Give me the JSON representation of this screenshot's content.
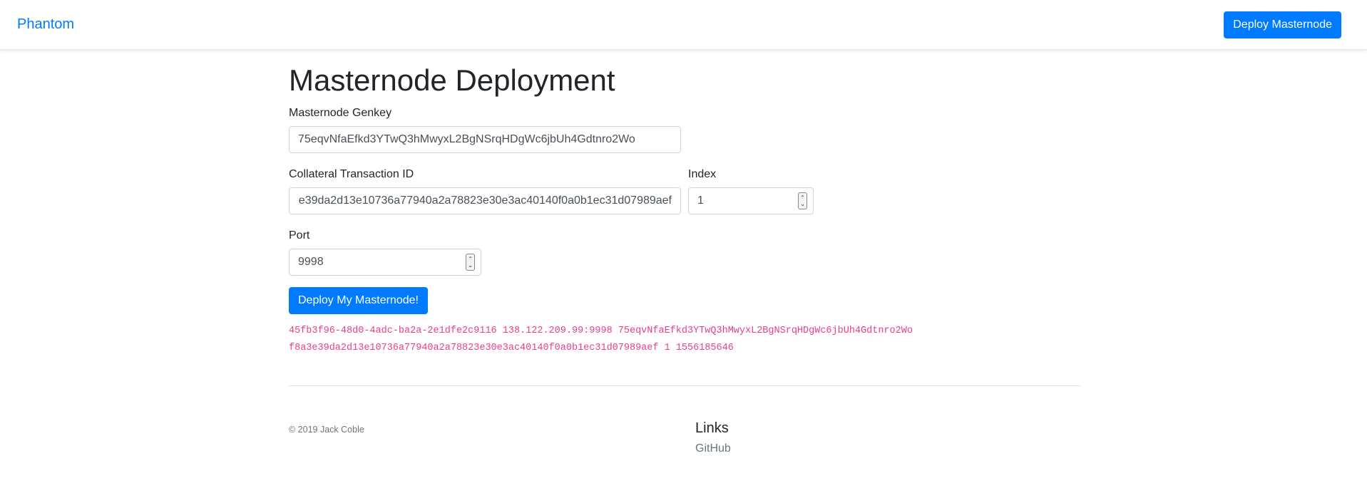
{
  "navbar": {
    "brand": "Phantom",
    "deploy_button_label": "Deploy Masternode"
  },
  "main": {
    "title": "Masternode Deployment",
    "genkey": {
      "label": "Masternode Genkey",
      "value": "75eqvNfaEfkd3YTwQ3hMwyxL2BgNSrqHDgWc6jbUh4Gdtnro2Wo"
    },
    "collateral": {
      "label": "Collateral Transaction ID",
      "value_visible": "e39da2d13e10736a77940a2a78823e30e3ac40140f0a0b1ec31d07989aef"
    },
    "index": {
      "label": "Index",
      "value": "1"
    },
    "port": {
      "label": "Port",
      "value": "9998"
    },
    "submit_label": "Deploy My Masternode!",
    "output_lines": [
      "45fb3f96-48d0-4adc-ba2a-2e1dfe2c9116 138.122.209.99:9998 75eqvNfaEfkd3YTwQ3hMwyxL2BgNSrqHDgWc6jbUh4Gdtnro2Wo",
      "f8a3e39da2d13e10736a77940a2a78823e30e3ac40140f0a0b1ec31d07989aef 1 1556185646"
    ]
  },
  "footer": {
    "copyright": "© 2019 Jack Coble",
    "links_title": "Links",
    "links": [
      "GitHub"
    ]
  },
  "colors": {
    "primary": "#007bff",
    "output_text": "#e83e8c"
  }
}
